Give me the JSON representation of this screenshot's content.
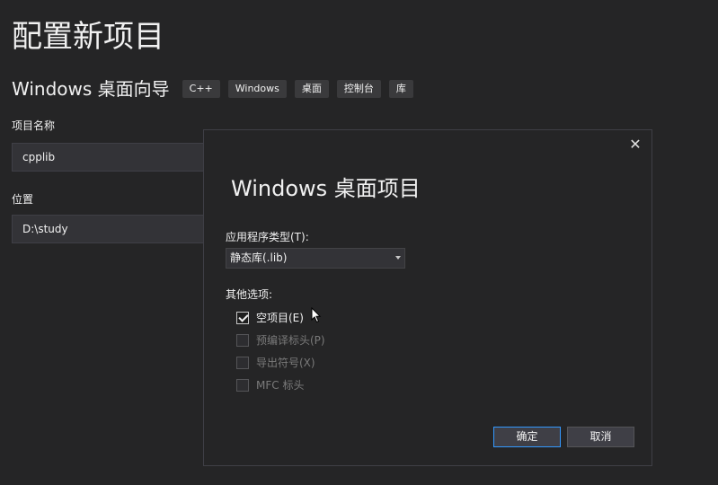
{
  "page": {
    "title": "配置新项目",
    "subtitle": "Windows 桌面向导",
    "tags": [
      "C++",
      "Windows",
      "桌面",
      "控制台",
      "库"
    ]
  },
  "form": {
    "project_name_label": "项目名称",
    "project_name_value": "cpplib",
    "location_label": "位置",
    "location_value": "D:\\study"
  },
  "dialog": {
    "close_glyph": "✕",
    "title": "Windows 桌面项目",
    "app_type_label": "应用程序类型(T):",
    "app_type_value": "静态库(.lib)",
    "other_options_label": "其他选项:",
    "options": [
      {
        "label": "空项目(E)",
        "checked": true,
        "enabled": true
      },
      {
        "label": "预编译标头(P)",
        "checked": false,
        "enabled": false
      },
      {
        "label": "导出符号(X)",
        "checked": false,
        "enabled": false
      },
      {
        "label": "MFC 标头",
        "checked": false,
        "enabled": false
      }
    ],
    "ok_label": "确定",
    "cancel_label": "取消"
  },
  "colors": {
    "background": "#252526",
    "accent_border": "#3399ff",
    "disabled_text": "#7a7a7a"
  }
}
